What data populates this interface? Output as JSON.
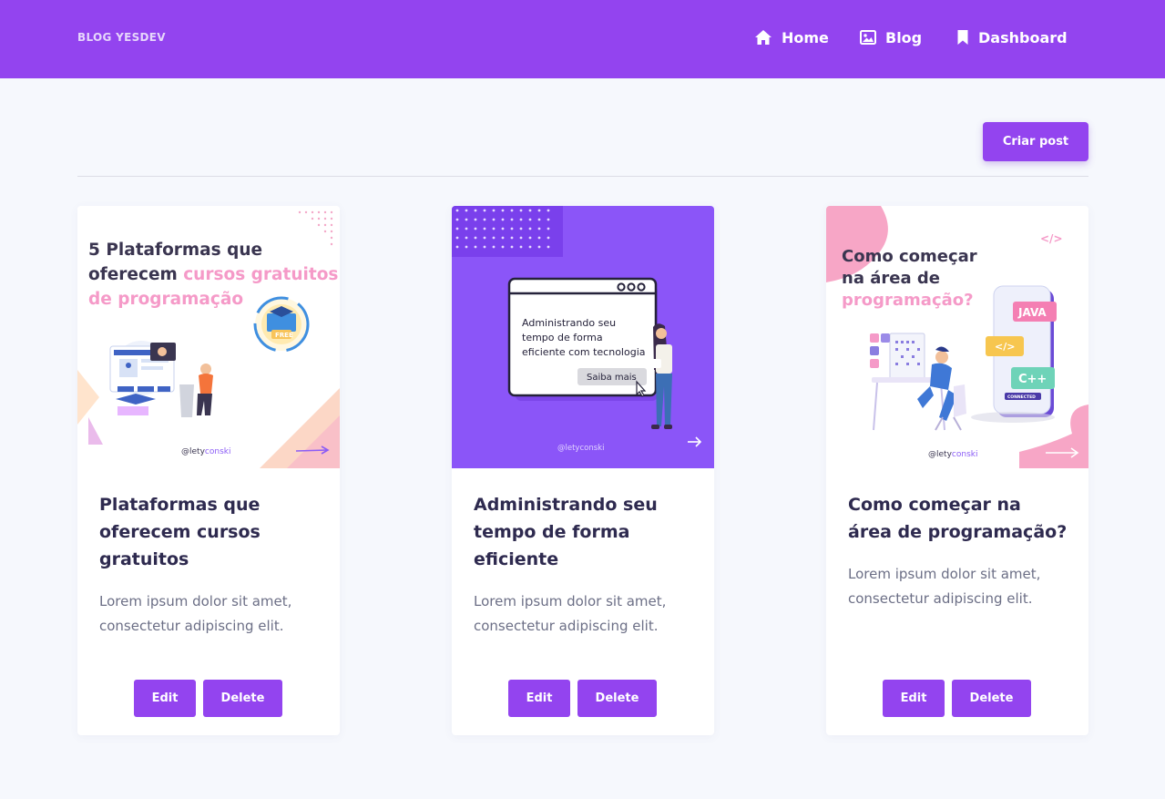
{
  "navbar": {
    "brand": "BLOG YESDEV",
    "links": [
      {
        "label": "Home",
        "icon": "home-icon"
      },
      {
        "label": "Blog",
        "icon": "image-icon"
      },
      {
        "label": "Dashboard",
        "icon": "bookmark-icon"
      }
    ]
  },
  "toolbar": {
    "create_label": "Criar post"
  },
  "colors": {
    "accent": "#9344ef",
    "background": "#f6f8fd",
    "pink": "#f59ac8"
  },
  "posts": [
    {
      "title": "Plataformas que oferecem cursos gratuitos",
      "text": "Lorem ipsum dolor sit amet, consectetur adipiscing elit.",
      "edit_label": "Edit",
      "delete_label": "Delete",
      "thumb": {
        "line1": "5 Plataformas que",
        "line2a": "oferecem ",
        "line2b": "cursos gratuitos",
        "line3": "de programação",
        "badge": "FREE",
        "handle_a": "@lety",
        "handle_b": "conski"
      }
    },
    {
      "title": "Administrando seu tempo de forma eficiente",
      "text": "Lorem ipsum dolor sit amet, consectetur adipiscing elit.",
      "edit_label": "Edit",
      "delete_label": "Delete",
      "thumb": {
        "line1": "Administrando seu",
        "line2": "tempo de forma",
        "line3": "eficiente com tecnologia",
        "button": "Saiba mais",
        "handle": "@letyconski"
      }
    },
    {
      "title": "Como começar na área de programação?",
      "text": "Lorem ipsum dolor sit amet, consectetur adipiscing elit.",
      "edit_label": "Edit",
      "delete_label": "Delete",
      "thumb": {
        "line1": "Como começar",
        "line2": "na área de",
        "line3": "programação?",
        "code_tag": "</>",
        "lang1": "JAVA",
        "lang2": "</>",
        "lang3": "C++",
        "status": "CONNECTED",
        "handle_a": "@lety",
        "handle_b": "conski"
      }
    }
  ]
}
